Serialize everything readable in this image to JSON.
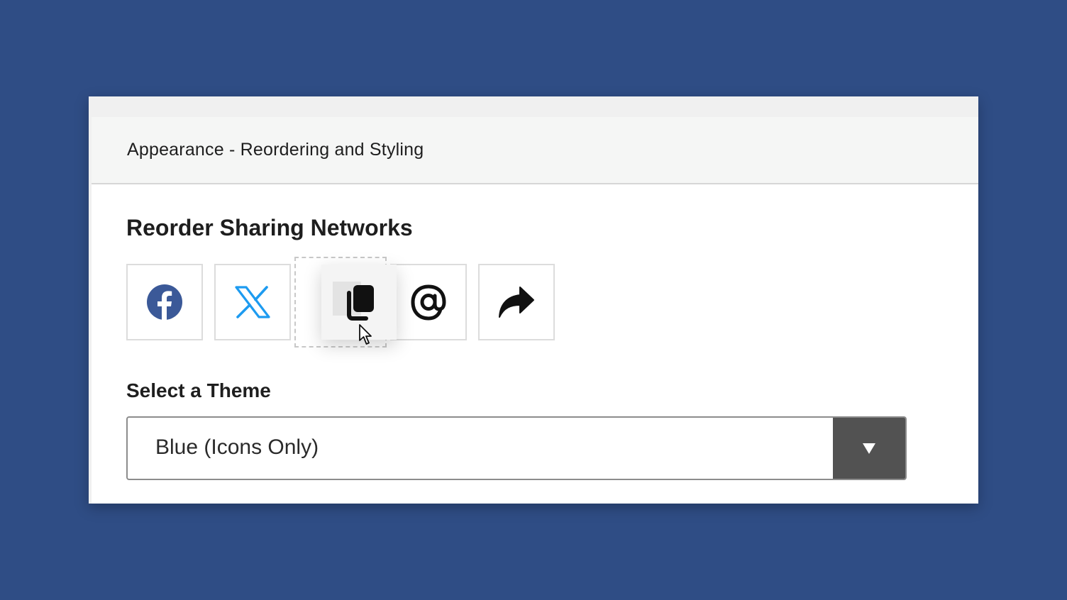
{
  "panel": {
    "header_title": "Appearance - Reordering and Styling"
  },
  "networks": {
    "heading": "Reorder Sharing Networks",
    "order": [
      {
        "name": "facebook",
        "icon": "facebook-icon",
        "color": "#3b5998"
      },
      {
        "name": "x",
        "icon": "x-logo-icon",
        "color": "#1d9bf0"
      },
      {
        "name": "copy-link",
        "icon": "copy-icon",
        "color": "#111111",
        "state": "dragging"
      },
      {
        "name": "threads",
        "icon": "threads-icon",
        "color": "#111111"
      },
      {
        "name": "share",
        "icon": "share-arrow-icon",
        "color": "#111111"
      }
    ]
  },
  "theme": {
    "label": "Select a Theme",
    "selected": "Blue (Icons Only)",
    "dropdown_icon": "triangle-down-icon"
  },
  "colors": {
    "background": "#2f4d85",
    "header_bg": "#f5f6f5",
    "select_button_bg": "#525252",
    "facebook": "#3b5998",
    "x_blue": "#1d9bf0"
  }
}
